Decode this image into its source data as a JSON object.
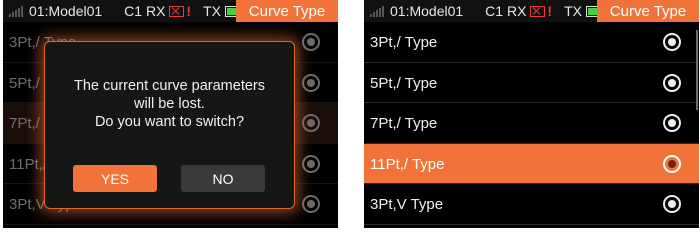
{
  "status": {
    "model": "01:Model01",
    "rx_label": "C1 RX",
    "rx_warning": "!",
    "tx_label": "TX",
    "screen_title": "Curve Type"
  },
  "curve_types": [
    {
      "label": "3Pt,/ Type",
      "selected": false
    },
    {
      "label": "5Pt,/ Type",
      "selected": false
    },
    {
      "label": "7Pt,/ Type",
      "selected": false
    },
    {
      "label": "11Pt,/ Type",
      "selected": true
    },
    {
      "label": "3Pt,V Type",
      "selected": false
    }
  ],
  "dialog": {
    "line1": "The current curve parameters",
    "line2": "will be lost.",
    "line3": "Do you want to switch?",
    "yes_label": "YES",
    "no_label": "NO"
  },
  "colors": {
    "accent": "#f2733a",
    "background": "#000000",
    "tx_battery": "#3cd63c",
    "rx_alert": "#e23c3c"
  },
  "icons": [
    "signal-strength-icon",
    "rx-disconnected-icon",
    "tx-battery-icon",
    "radio-icon"
  ]
}
